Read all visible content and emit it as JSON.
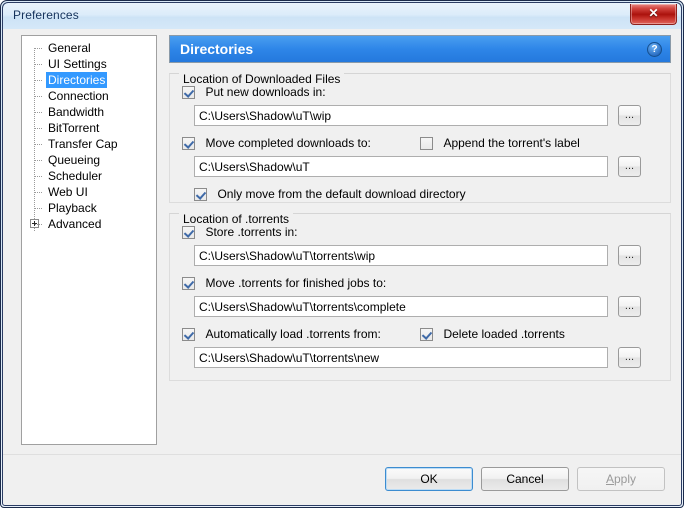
{
  "window": {
    "title": "Preferences",
    "close_label": "✕"
  },
  "sidebar": {
    "items": [
      {
        "label": "General",
        "selected": false,
        "expandable": false
      },
      {
        "label": "UI Settings",
        "selected": false,
        "expandable": false
      },
      {
        "label": "Directories",
        "selected": true,
        "expandable": false
      },
      {
        "label": "Connection",
        "selected": false,
        "expandable": false
      },
      {
        "label": "Bandwidth",
        "selected": false,
        "expandable": false
      },
      {
        "label": "BitTorrent",
        "selected": false,
        "expandable": false
      },
      {
        "label": "Transfer Cap",
        "selected": false,
        "expandable": false
      },
      {
        "label": "Queueing",
        "selected": false,
        "expandable": false
      },
      {
        "label": "Scheduler",
        "selected": false,
        "expandable": false
      },
      {
        "label": "Web UI",
        "selected": false,
        "expandable": false
      },
      {
        "label": "Playback",
        "selected": false,
        "expandable": false
      },
      {
        "label": "Advanced",
        "selected": false,
        "expandable": true
      }
    ]
  },
  "pane": {
    "title": "Directories",
    "help_label": "?"
  },
  "groups": {
    "downloaded": {
      "label": "Location of Downloaded Files",
      "put_new_downloads": {
        "label": "Put new downloads in:",
        "checked": true,
        "value": "C:\\Users\\Shadow\\uT\\wip",
        "browse_label": "..."
      },
      "move_completed": {
        "label": "Move completed downloads to:",
        "checked": true,
        "value": "C:\\Users\\Shadow\\uT",
        "browse_label": "..."
      },
      "append_label": {
        "label": "Append the torrent's label",
        "checked": false
      },
      "only_move_default": {
        "label": "Only move from the default download directory",
        "checked": true
      }
    },
    "torrents": {
      "label": "Location of .torrents",
      "store_torrents": {
        "label": "Store .torrents in:",
        "checked": true,
        "value": "C:\\Users\\Shadow\\uT\\torrents\\wip",
        "browse_label": "..."
      },
      "move_finished": {
        "label": "Move .torrents for finished jobs to:",
        "checked": true,
        "value": "C:\\Users\\Shadow\\uT\\torrents\\complete",
        "browse_label": "..."
      },
      "auto_load": {
        "label": "Automatically load .torrents from:",
        "checked": true,
        "value": "C:\\Users\\Shadow\\uT\\torrents\\new",
        "browse_label": "..."
      },
      "delete_loaded": {
        "label": "Delete loaded .torrents",
        "checked": true
      }
    }
  },
  "footer": {
    "ok": "OK",
    "cancel": "Cancel",
    "apply_accel": "A",
    "apply_rest": "pply"
  },
  "colors": {
    "accent": "#2e86e8",
    "selection": "#3399ff",
    "close_red": "#ab120d",
    "title_text": "#15335c"
  }
}
